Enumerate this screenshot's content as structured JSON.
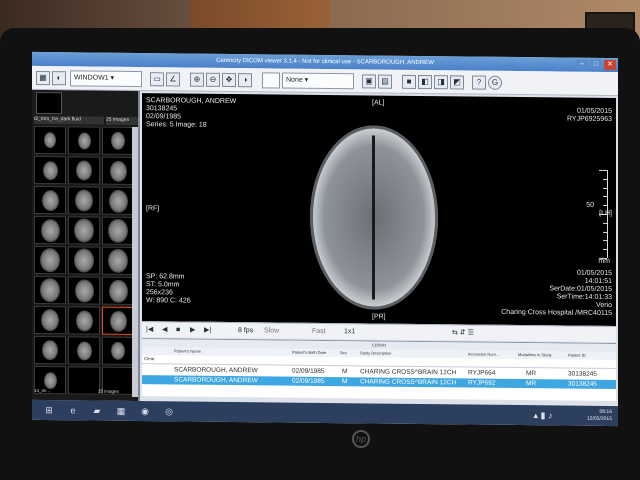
{
  "app": {
    "title": "Centricity DICOM viewer 3.1.4 - Not for clinical use - SCARBOROUGH, ANDREW"
  },
  "toolbar": {
    "window_select": "WINDOW1",
    "none_select": "None"
  },
  "thumbs": {
    "series_label": "t2_trim_tra_dark fluid",
    "series_count": "25 images",
    "footer_left": "14_Im ...",
    "footer_right": "25 images"
  },
  "viewer": {
    "patient_name": "SCARBOROUGH, ANDREW",
    "patient_id": "30138245",
    "dob": "02/09/1985",
    "series_image": "Series: 5 Image: 18",
    "orient_top": "[AL]",
    "orient_left": "[RF]",
    "orient_bottom": "[PR]",
    "date_top": "01/05/2015",
    "accession_top": "RYJP6925963",
    "sp": "SP: 62.8mm",
    "st": "ST: 5.0mm",
    "matrix": "256x236",
    "wl": "W: 890 C: 426",
    "date_bottom": "01/05/2015",
    "time_bottom": "14:01:51",
    "ser_date": "SerDate:01/05/2015",
    "ser_time": "SerTime:14:01:33",
    "scanner": "Verio",
    "institution": "Charing Cross Hospital /MRC40115",
    "ruler_label": "50",
    "ruler_side": "[LH]",
    "ruler_unit": "mm"
  },
  "playbar": {
    "fps": "8 fps",
    "speed_label": "Slow",
    "fast_label": "Fast",
    "layout": "1x1"
  },
  "studylist": {
    "top_label": "CDDVD",
    "headers": [
      "Patient's Name",
      "Patient's Birth Date",
      "Sex",
      "Study Description",
      "Accession Num...",
      "Modalities in Study",
      "Patient ID"
    ],
    "clear_label": "Clear",
    "rows": [
      {
        "name": "SCARBOROUGH, ANDREW",
        "dob": "02/09/1985",
        "sex": "M",
        "desc": "CHARING CROSS^BRAIN 12CH",
        "acc": "RYJP664",
        "mod": "MR",
        "pid": "30138245"
      },
      {
        "name": "SCARBOROUGH, ANDREW",
        "dob": "02/09/1985",
        "sex": "M",
        "desc": "CHARING CROSS^BRAIN 12CH",
        "acc": "RYJP692",
        "mod": "MR",
        "pid": "30138245"
      }
    ]
  },
  "taskbar": {
    "time": "08:16",
    "date": "12/05/2015"
  },
  "colors": {
    "title_bar": "#4a80c8",
    "selection": "#3ea6e0",
    "taskbar": "#2c3f5e"
  }
}
